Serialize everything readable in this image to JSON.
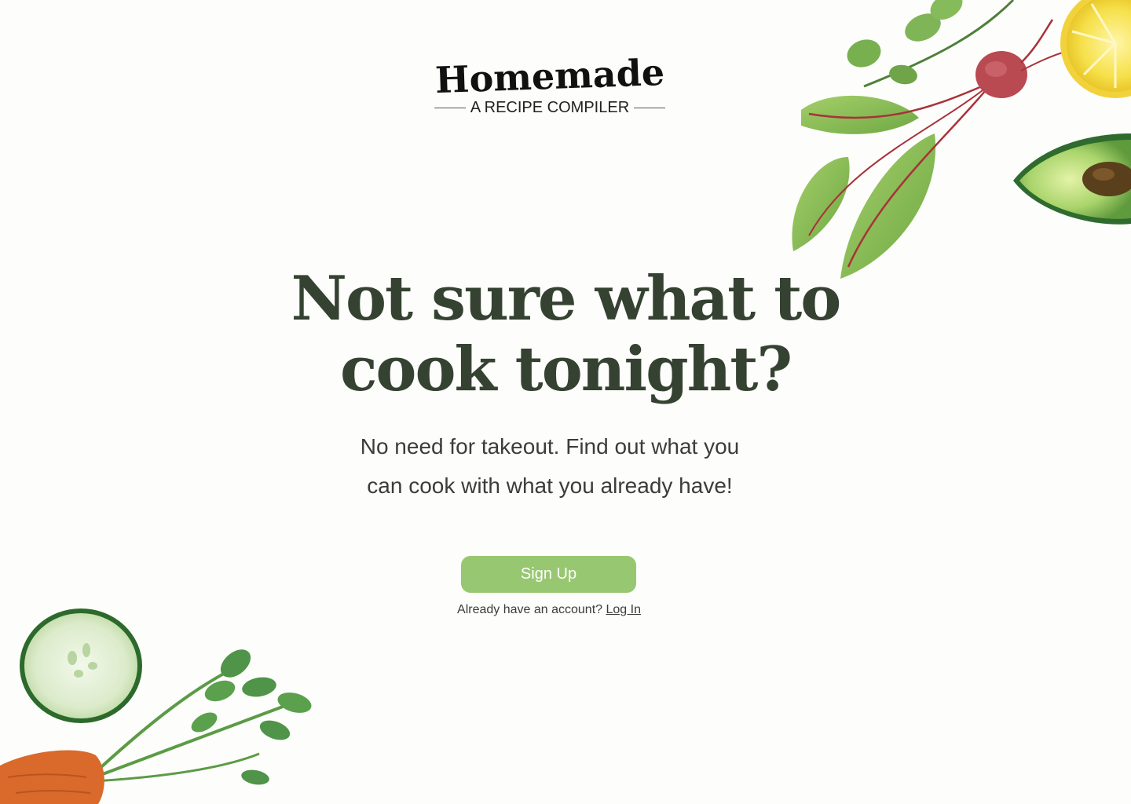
{
  "logo": {
    "wordmark": "Homemade",
    "tagline": "A RECIPE COMPILER"
  },
  "hero": {
    "title_line1": "Not sure what to",
    "title_line2": "cook tonight?",
    "subtitle_line1": "No need for takeout. Find out what you",
    "subtitle_line2": "can cook with what you already have!"
  },
  "cta": {
    "signup_label": "Sign Up",
    "login_prompt": "Already have an account?",
    "login_label": "Log In"
  },
  "colors": {
    "background": "#fdfdfb",
    "heading": "#354232",
    "button": "#98c771",
    "button_text": "#ffffff"
  }
}
